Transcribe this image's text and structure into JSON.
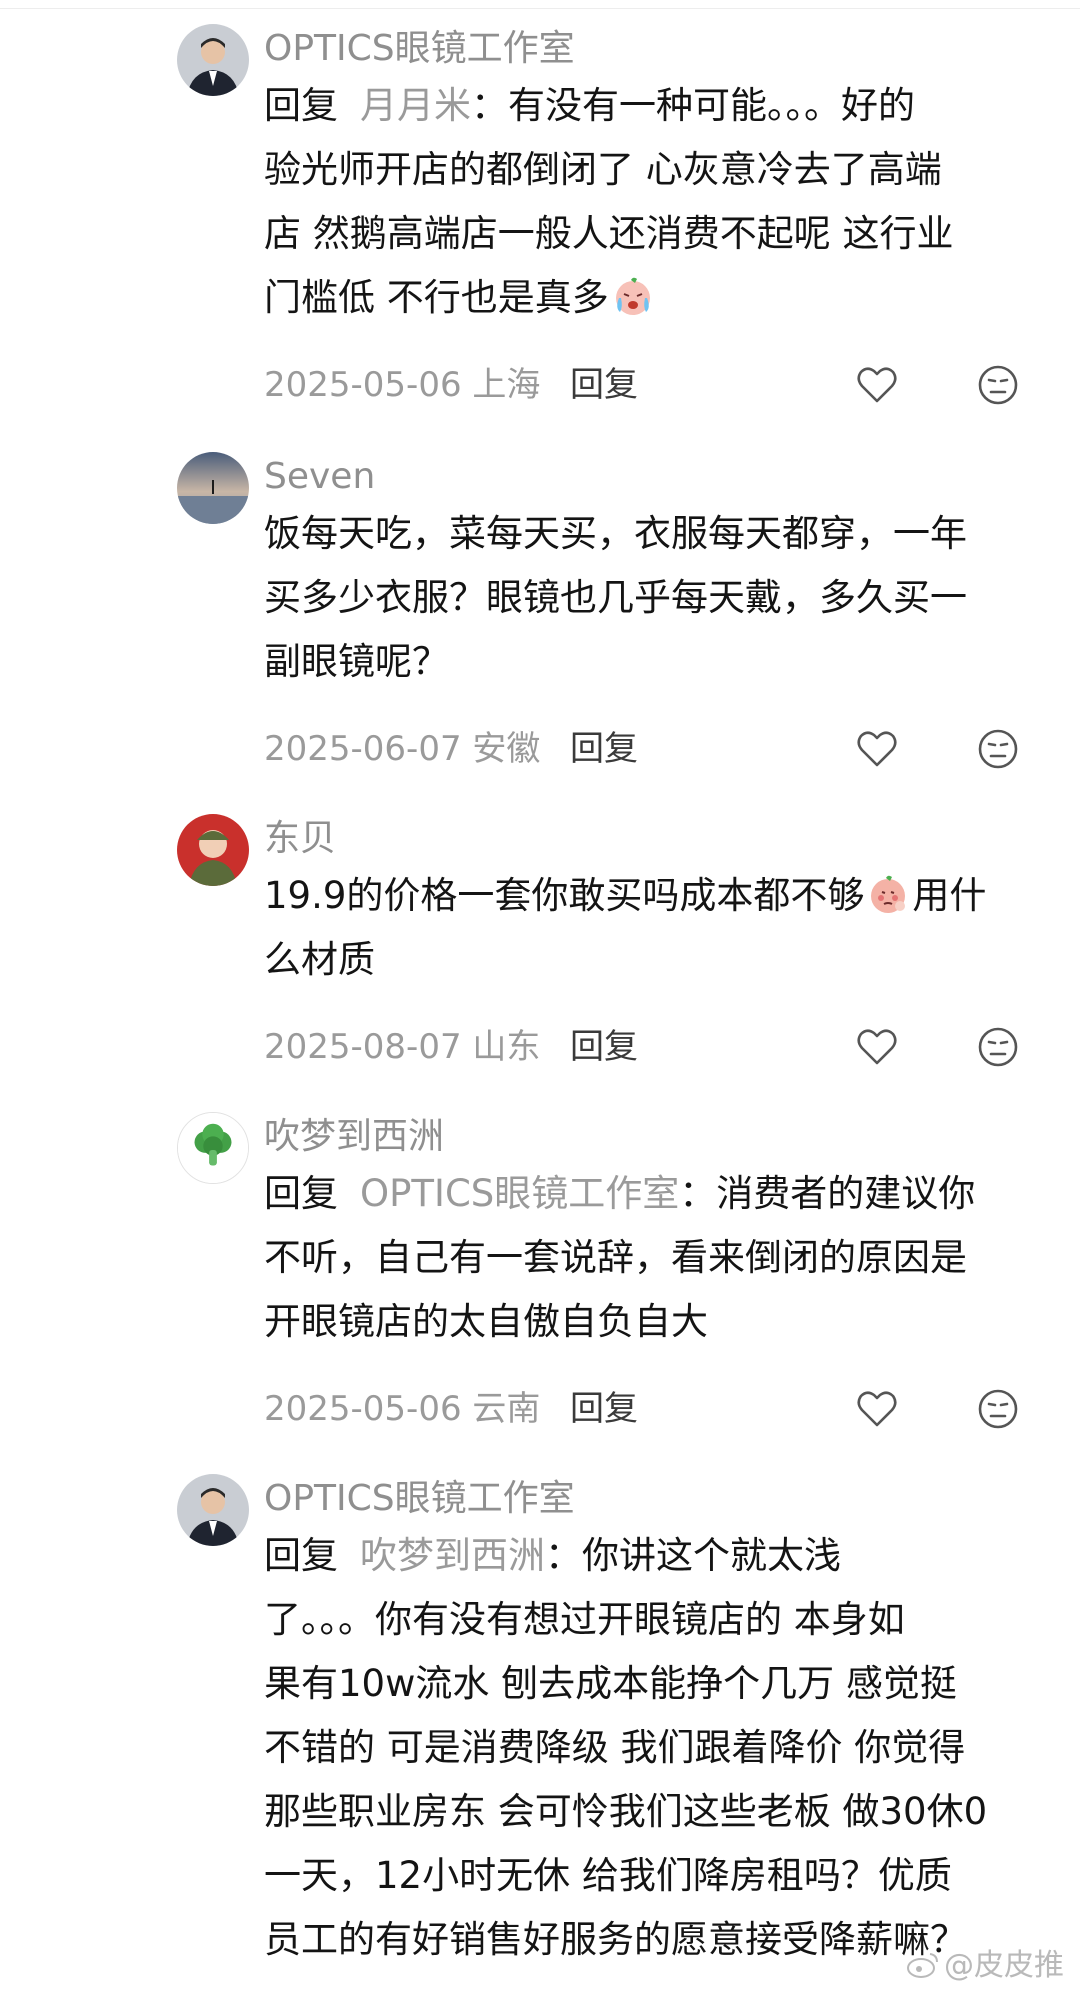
{
  "comments": [
    {
      "username": "OPTICS眼镜工作室",
      "reply_prefix": "回复",
      "mention": "月月米",
      "colon": "：",
      "lines": [
        "有没有一种可能。。。好的",
        "验光师开店的都倒闭了 心灰意冷去了高端",
        "店 然鹅高端店一般人还消费不起呢 这行业",
        "门槛低 不行也是真多"
      ],
      "emoji": "crying-emoji",
      "date_location": "2025-05-06 上海",
      "reply_label": "回复",
      "avatar": "man-in-suit-avatar"
    },
    {
      "username": "Seven",
      "lines": [
        "饭每天吃，菜每天买，衣服每天都穿，一年",
        "买多少衣服？眼镜也几乎每天戴，多久买一",
        "副眼镜呢？"
      ],
      "date_location": "2025-06-07 安徽",
      "reply_label": "回复",
      "avatar": "sunset-lake-avatar"
    },
    {
      "username": "东贝",
      "lines_before_emoji": "19.9的价格一套你敢买吗成本都不够",
      "emoji": "shy-peach-emoji",
      "lines_after_emoji": "用什",
      "line2": "么材质",
      "date_location": "2025-08-07 山东",
      "reply_label": "回复",
      "avatar": "child-in-uniform-avatar"
    },
    {
      "username": "吹梦到西洲",
      "reply_prefix": "回复",
      "mention": "OPTICS眼镜工作室",
      "colon": "：",
      "lines": [
        "消费者的建议你",
        "不听，自己有一套说辞，看来倒闭的原因是",
        "开眼镜店的太自傲自负自大"
      ],
      "date_location": "2025-05-06 云南",
      "reply_label": "回复",
      "avatar": "broccoli-avatar"
    },
    {
      "username": "OPTICS眼镜工作室",
      "reply_prefix": "回复",
      "mention": "吹梦到西洲",
      "colon": "：",
      "lines": [
        "你讲这个就太浅",
        "了。。。你有没有想过开眼镜店的 本身如",
        "果有10w流水 刨去成本能挣个几万 感觉挺",
        "不错的 可是消费降级 我们跟着降价 你觉得",
        "那些职业房东 会可怜我们这些老板 做30休0",
        "一天，12小时无休 给我们降房租吗？优质",
        "员工的有好销售好服务的愿意接受降薪嘛？"
      ],
      "avatar": "man-in-suit-avatar"
    }
  ],
  "watermark": "@皮皮推",
  "colors": {
    "username": "#8f8f8f",
    "mention": "#9a9a9a",
    "body_text": "#141414",
    "meta_text": "#9a9a9a"
  }
}
